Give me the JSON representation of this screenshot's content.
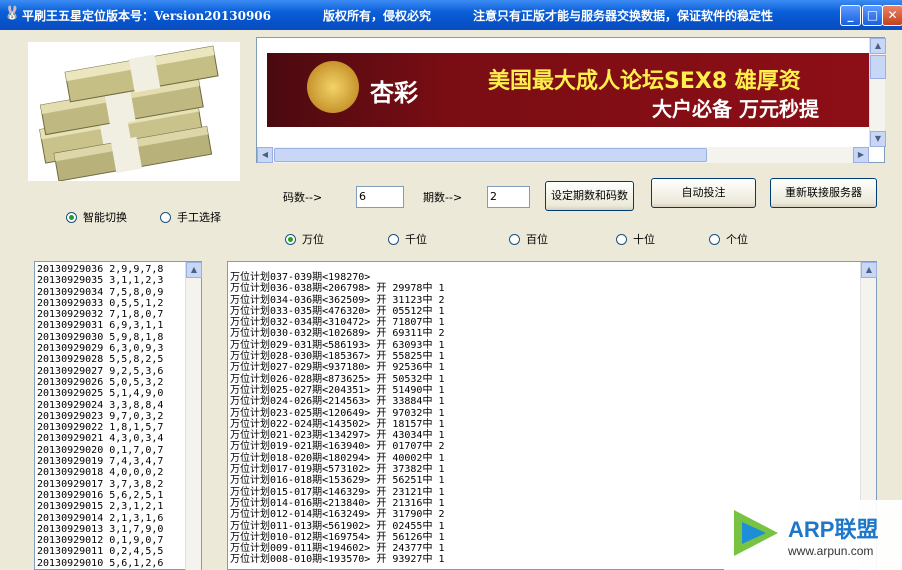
{
  "titlebar": {
    "version": "平刷王五星定位版本号：Version20130906",
    "copyright": "版权所有，侵权必究",
    "note": "注意只有正版才能与服务器交换数据，保证软件的稳定性"
  },
  "banner": {
    "logo_text": "杏彩",
    "main_text": "美国最大成人论坛SEX8  雄厚资",
    "sub_text": "大户必备 万元秒提"
  },
  "mode_radios": [
    {
      "label": "智能切换",
      "selected": true
    },
    {
      "label": "手工选择",
      "selected": false
    }
  ],
  "settings": {
    "code_label": "码数-->",
    "code_value": "6",
    "period_label": "期数-->",
    "period_value": "2"
  },
  "buttons": {
    "set": "设定期数和码数",
    "auto_bet": "自动投注",
    "reconnect": "重新联接服务器"
  },
  "position_radios": [
    {
      "label": "万位",
      "selected": true
    },
    {
      "label": "千位",
      "selected": false
    },
    {
      "label": "百位",
      "selected": false
    },
    {
      "label": "十位",
      "selected": false
    },
    {
      "label": "个位",
      "selected": false
    }
  ],
  "history": [
    "20130929036 2,9,9,7,8",
    "20130929035 3,1,1,2,3",
    "20130929034 7,5,8,0,9",
    "20130929033 0,5,5,1,2",
    "20130929032 7,1,8,0,7",
    "20130929031 6,9,3,1,1",
    "20130929030 5,9,8,1,8",
    "20130929029 6,3,0,9,3",
    "20130929028 5,5,8,2,5",
    "20130929027 9,2,5,3,6",
    "20130929026 5,0,5,3,2",
    "20130929025 5,1,4,9,0",
    "20130929024 3,3,8,8,4",
    "20130929023 9,7,0,3,2",
    "20130929022 1,8,1,5,7",
    "20130929021 4,3,0,3,4",
    "20130929020 0,1,7,0,7",
    "20130929019 7,4,3,4,7",
    "20130929018 4,0,0,0,2",
    "20130929017 3,7,3,8,2",
    "20130929016 5,6,2,5,1",
    "20130929015 2,3,1,2,1",
    "20130929014 2,1,3,1,6",
    "20130929013 3,1,7,9,0",
    "20130929012 0,1,9,0,7",
    "20130929011 0,2,4,5,5",
    "20130929010 5,6,1,2,6"
  ],
  "plans": [
    "万位计划037-039期<198270>",
    "万位计划036-038期<206798> 开 29978中 1",
    "万位计划034-036期<362509> 开 31123中 2",
    "万位计划033-035期<476320> 开 05512中 1",
    "万位计划032-034期<310472> 开 71807中 1",
    "万位计划030-032期<102689> 开 69311中 2",
    "万位计划029-031期<586193> 开 63093中 1",
    "万位计划028-030期<185367> 开 55825中 1",
    "万位计划027-029期<937180> 开 92536中 1",
    "万位计划026-028期<873625> 开 50532中 1",
    "万位计划025-027期<204351> 开 51490中 1",
    "万位计划024-026期<214563> 开 33884中 1",
    "万位计划023-025期<120649> 开 97032中 1",
    "万位计划022-024期<143502> 开 18157中 1",
    "万位计划021-023期<134297> 开 43034中 1",
    "万位计划019-021期<163940> 开 01707中 2",
    "万位计划018-020期<180294> 开 40002中 1",
    "万位计划017-019期<573102> 开 37382中 1",
    "万位计划016-018期<153629> 开 56251中 1",
    "万位计划015-017期<146329> 开 23121中 1",
    "万位计划014-016期<213840> 开 21316中 1",
    "万位计划012-014期<163249> 开 31790中 2",
    "万位计划011-013期<561902> 开 02455中 1",
    "万位计划010-012期<169754> 开 56126中 1",
    "万位计划009-011期<194602> 开 24377中 1",
    "万位计划008-010期<193570> 开 93927中 1"
  ],
  "watermark": {
    "brand": "ARP联盟",
    "url": "www.arpun.com"
  }
}
